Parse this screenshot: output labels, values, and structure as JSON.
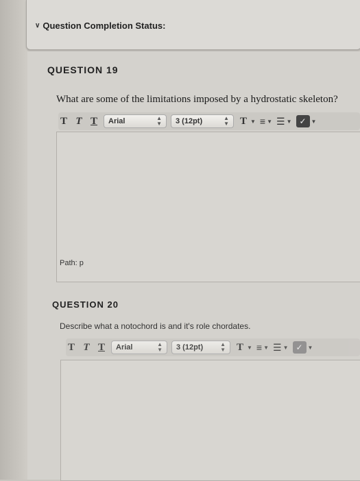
{
  "status": {
    "label": "Question Completion Status:"
  },
  "questions": [
    {
      "title": "QUESTION 19",
      "prompt": "What are some of the limitations imposed by a hydrostatic skeleton?",
      "font": "Arial",
      "size": "3 (12pt)",
      "path_label": "Path:",
      "path_value": "p"
    },
    {
      "title": "QUESTION 20",
      "prompt": "Describe what a notochord is and it's role chordates.",
      "font": "Arial",
      "size": "3 (12pt)"
    }
  ],
  "toolbar": {
    "bold": "T",
    "italic": "T",
    "underline": "T",
    "text_color": "T"
  },
  "icons": [
    "chevron-down-icon",
    "align-icon",
    "list-icon",
    "spellcheck-icon"
  ]
}
